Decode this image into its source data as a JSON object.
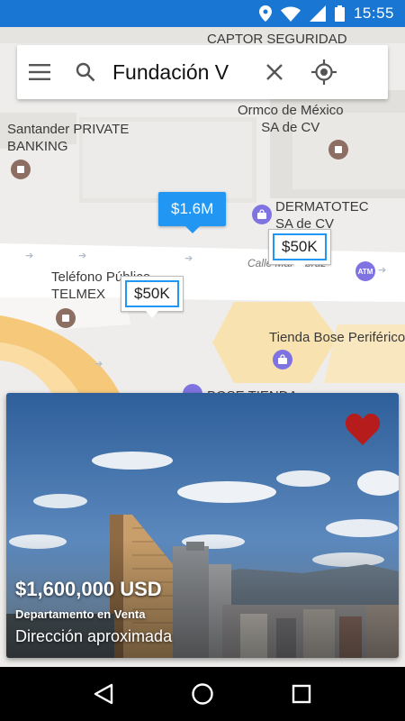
{
  "status_bar": {
    "time": "15:55"
  },
  "search": {
    "value": "Fundación V"
  },
  "map": {
    "labels": {
      "captor": "CAPTOR SEGURIDAD",
      "santander": "Santander PRIVATE\nBANKING",
      "ormco": "Ormco de México\nSA de CV",
      "dermatotec": "DERMATOTEC\nSA de CV",
      "street": "Calle Mar Libruz",
      "telefono": "Teléfono Público\nTELMEX",
      "bose": "Tienda Bose Periférico",
      "bose_tienda": "BOSE TIENDA"
    },
    "atm_label": "ATM",
    "markers": {
      "selected": "$1.6M",
      "marker_a": "$50K",
      "marker_b": "$50K"
    }
  },
  "listing": {
    "price": "$1,600,000 USD",
    "type": "Departamento en Venta",
    "address": "Dirección aproximada",
    "favorite": true,
    "heart_color": "#b71c1c"
  },
  "colors": {
    "status_bar": "#1976d2",
    "marker": "#2196f3",
    "poi_brown": "#8d6e63",
    "poi_blue": "#7e73e0"
  }
}
